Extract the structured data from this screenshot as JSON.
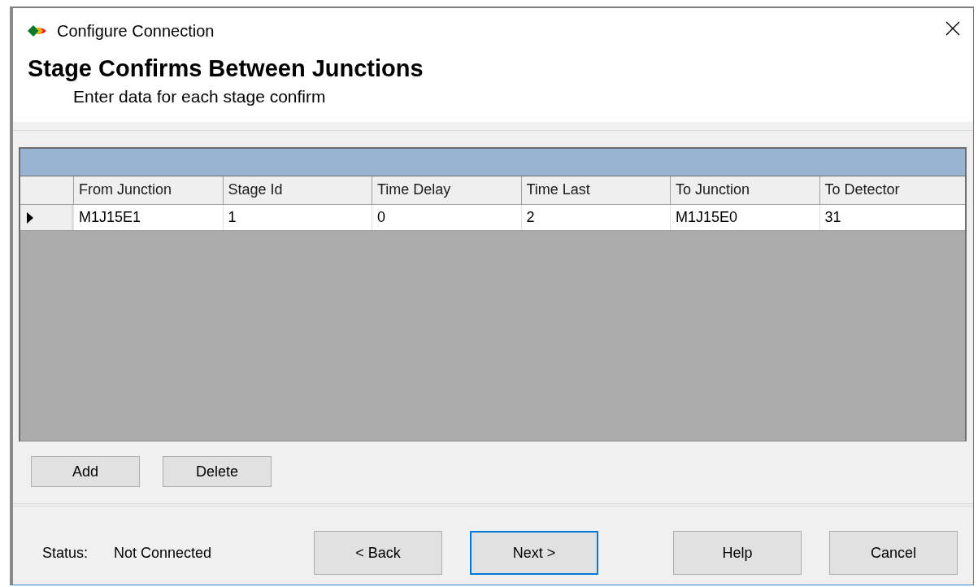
{
  "window": {
    "title": "Configure Connection"
  },
  "header": {
    "title": "Stage Confirms Between Junctions",
    "subtitle": "Enter data for each stage confirm"
  },
  "grid": {
    "columns": [
      "From Junction",
      "Stage Id",
      "Time Delay",
      "Time Last",
      "To Junction",
      "To Detector"
    ],
    "rows": [
      {
        "current": true,
        "cells": [
          "M1J15E1",
          "1",
          "0",
          "2",
          "M1J15E0",
          "31"
        ]
      }
    ]
  },
  "row_buttons": [
    "Add",
    "Delete"
  ],
  "status": {
    "label": "Status:",
    "value": "Not Connected"
  },
  "buttons": [
    {
      "label": "< Back",
      "default": false
    },
    {
      "label": "Next >",
      "default": true
    },
    {
      "label": "Help",
      "default": false
    },
    {
      "label": "Cancel",
      "default": false
    }
  ]
}
